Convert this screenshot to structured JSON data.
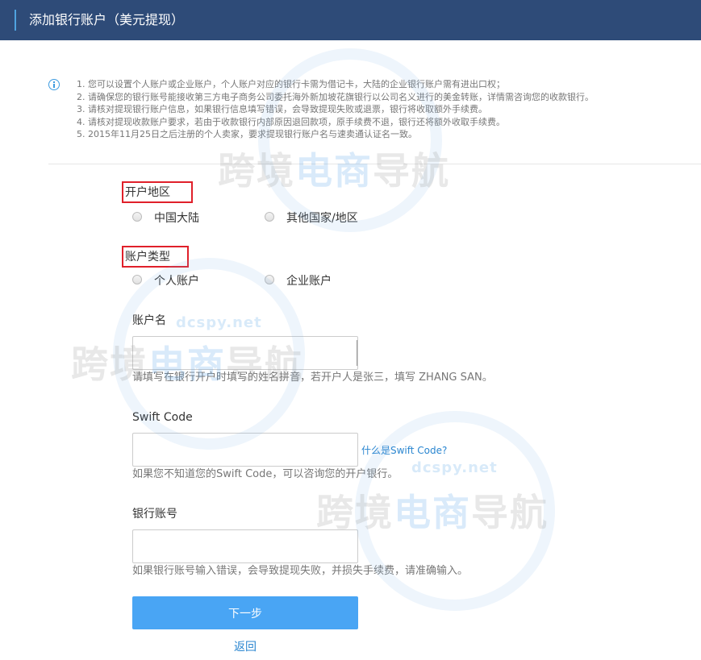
{
  "header": {
    "title": "添加银行账户（美元提现）"
  },
  "notices": [
    "1. 您可以设置个人账户或企业账户，个人账户对应的银行卡需为借记卡，大陆的企业银行账户需有进出口权；",
    "2. 请确保您的银行账号能接收第三方电子商务公司委托海外新加坡花旗银行以公司名义进行的美金转账，详情需咨询您的收款银行。",
    "3. 请核对提现银行账户信息，如果银行信息填写错误，会导致提现失败或退票，银行将收取额外手续费。",
    "4. 请核对提现收款账户要求，若由于收款银行内部原因退回款项，原手续费不退，银行还将额外收取手续费。",
    "5. 2015年11月25日之后注册的个人卖家，要求提现银行账户名与速卖通认证名一致。"
  ],
  "region": {
    "label": "开户地区",
    "options": [
      "中国大陆",
      "其他国家/地区"
    ]
  },
  "account_type": {
    "label": "账户类型",
    "options": [
      "个人账户",
      "企业账户"
    ]
  },
  "account_name": {
    "label": "账户名",
    "value": "",
    "hint": "请填写在银行开户时填写的姓名拼音，若开户人是张三，填写 ZHANG SAN。"
  },
  "swift_code": {
    "label": "Swift Code",
    "value": "",
    "help_link": "什么是Swift Code?",
    "hint": "如果您不知道您的Swift Code，可以咨询您的开户银行。"
  },
  "bank_account": {
    "label": "银行账号",
    "value": "",
    "hint": "如果银行账号输入错误，会导致提现失败，并损失手续费，请准确输入。"
  },
  "actions": {
    "next_label": "下一步",
    "back_label": "返回"
  },
  "watermark": {
    "text_gray": "跨境",
    "text_blue": "电商",
    "text_gray2": "导航",
    "url": "dcspy.net"
  },
  "colors": {
    "header_bg": "#2e4b78",
    "primary": "#49a5f4",
    "link": "#2a86d0",
    "highlight_box": "#e0202a"
  }
}
